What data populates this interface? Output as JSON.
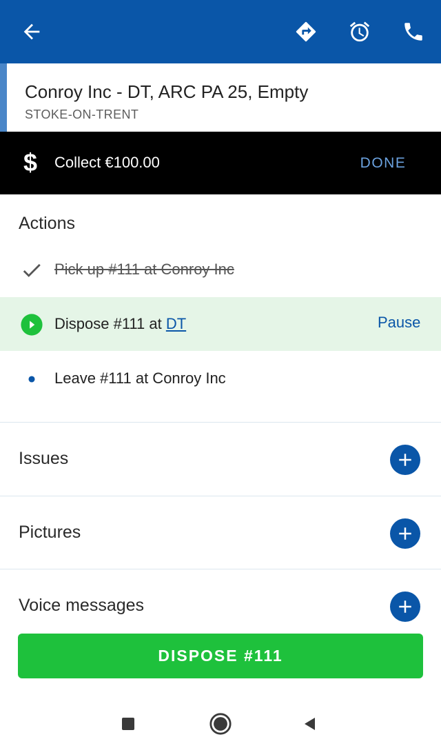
{
  "colors": {
    "topbar": "#0a56a8",
    "accent_green": "#1ec13c",
    "active_row_bg": "#e5f5e7",
    "done_text": "#6ba2df"
  },
  "topbar": {
    "icons": [
      "arrow-left-icon",
      "directions-icon",
      "alarm-icon",
      "phone-icon"
    ]
  },
  "header": {
    "title": "Conroy Inc - DT, ARC PA 25, Empty",
    "subtitle": "STOKE-ON-TRENT"
  },
  "collect": {
    "icon": "dollar-icon",
    "text": "Collect €100.00",
    "done_label": "DONE"
  },
  "actions": {
    "heading": "Actions",
    "items": [
      {
        "status": "done",
        "icon": "check-icon",
        "label": "Pick up #111 at Conroy Inc"
      },
      {
        "status": "active",
        "icon": "play-circle-icon",
        "label_prefix": "Dispose #111 at ",
        "link": "DT",
        "action_label": "Pause"
      },
      {
        "status": "pending",
        "icon": "dot-icon",
        "label": "Leave #111 at Conroy Inc"
      }
    ]
  },
  "sections": {
    "issues": "Issues",
    "pictures": "Pictures",
    "voice": "Voice messages"
  },
  "primary_button": "DISPOSE #111",
  "system_nav": {
    "icons": [
      "square-icon",
      "circle-icon",
      "triangle-back-icon"
    ]
  }
}
